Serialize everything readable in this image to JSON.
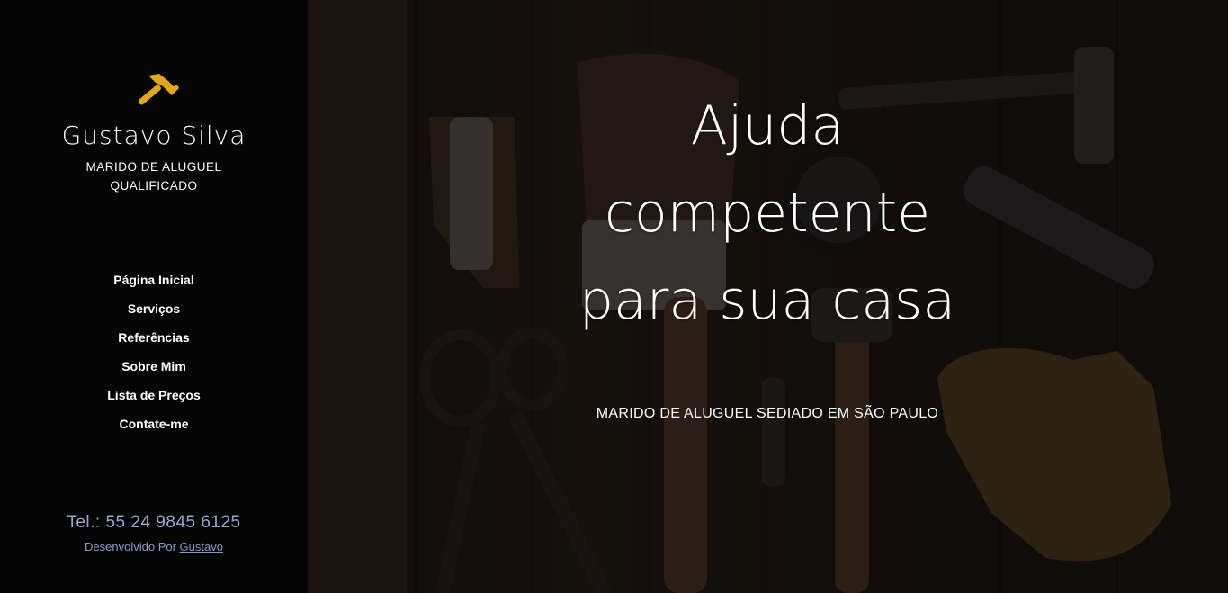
{
  "sidebar": {
    "logo_icon": "hammer-icon",
    "brand_name": "Gustavo Silva",
    "tagline_line1": "MARIDO DE ALUGUEL",
    "tagline_line2": "QUALIFICADO",
    "nav": [
      {
        "label": "Página Inicial"
      },
      {
        "label": "Serviços"
      },
      {
        "label": "Referências"
      },
      {
        "label": "Sobre Mim"
      },
      {
        "label": "Lista de Preços"
      },
      {
        "label": "Contate-me"
      }
    ],
    "phone": "Tel.: 55 24 9845 6125",
    "credit_prefix": "Desenvolvido Por",
    "credit_link": "Gustavo"
  },
  "hero": {
    "headline_line1": "Ajuda",
    "headline_line2": "competente",
    "headline_line3": "para sua casa",
    "subtitle": "MARIDO DE ALUGUEL SEDIADO EM SÃO PAULO"
  },
  "colors": {
    "sidebar_bg": "#050505",
    "accent": "#e0a61c",
    "phone_text": "#9aa7d0"
  }
}
